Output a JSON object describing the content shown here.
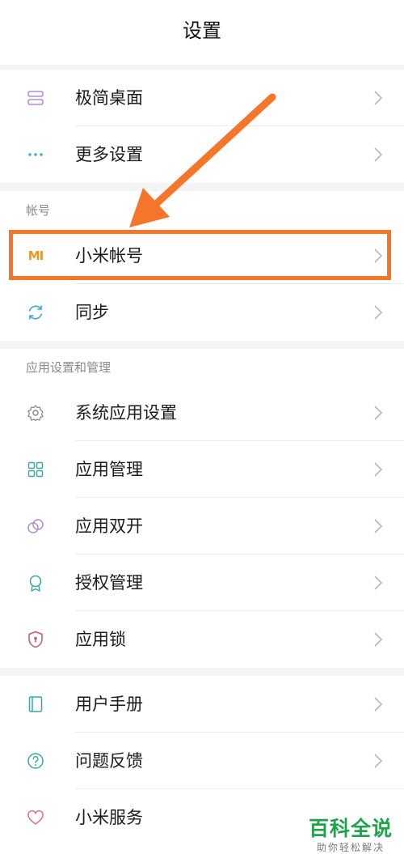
{
  "header": {
    "title": "设置"
  },
  "sections": {
    "top": [
      {
        "label": "极简桌面",
        "icon": "minimal-desktop-icon"
      },
      {
        "label": "更多设置",
        "icon": "more-dots-icon"
      }
    ],
    "account": {
      "title": "帐号",
      "items": [
        {
          "label": "小米帐号",
          "icon": "mi-logo-icon"
        },
        {
          "label": "同步",
          "icon": "sync-icon"
        }
      ]
    },
    "apps": {
      "title": "应用设置和管理",
      "items": [
        {
          "label": "系统应用设置",
          "icon": "gear-icon"
        },
        {
          "label": "应用管理",
          "icon": "grid-icon"
        },
        {
          "label": "应用双开",
          "icon": "dual-circle-icon"
        },
        {
          "label": "授权管理",
          "icon": "badge-icon"
        },
        {
          "label": "应用锁",
          "icon": "shield-lock-icon"
        }
      ]
    },
    "misc": [
      {
        "label": "用户手册",
        "icon": "book-icon"
      },
      {
        "label": "问题反馈",
        "icon": "question-icon"
      },
      {
        "label": "小米服务",
        "icon": "heart-icon"
      }
    ]
  },
  "mi_logo_text": "MI",
  "watermark": {
    "main": "百科全说",
    "sub": "助你轻松解决"
  },
  "colors": {
    "highlight": "#f5762a",
    "watermark": "#1fa34a",
    "mi_orange": "#e7992e"
  }
}
